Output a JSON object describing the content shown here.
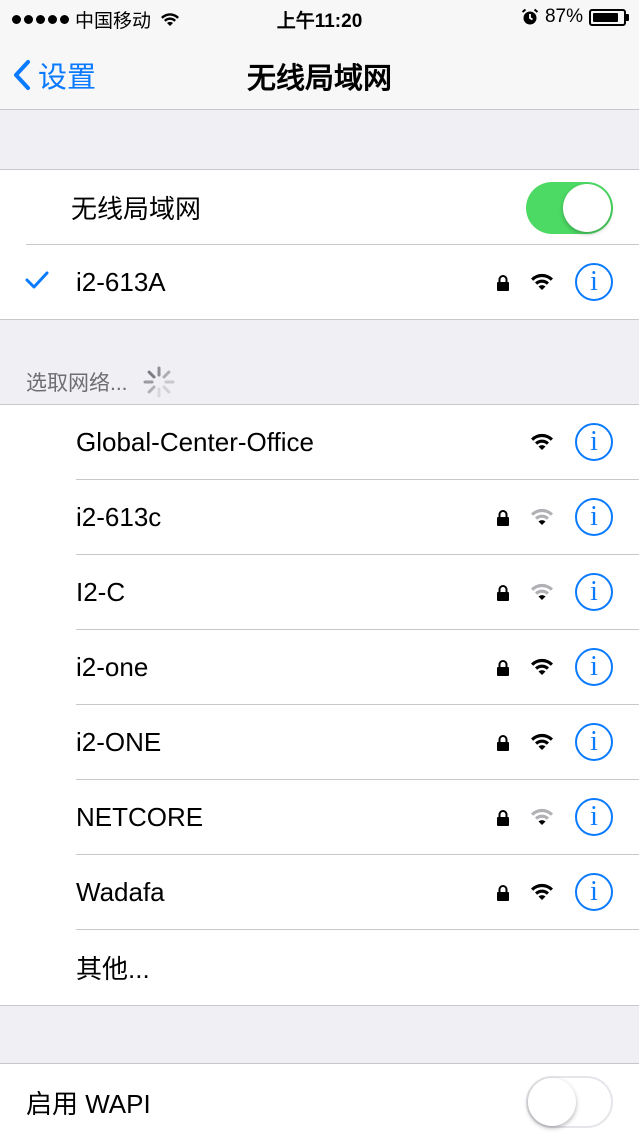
{
  "status_bar": {
    "carrier": "中国移动",
    "time": "上午11:20",
    "battery_percent": "87%",
    "signal_dots": 5,
    "battery_level": 0.87
  },
  "nav": {
    "back_label": "设置",
    "title": "无线局域网"
  },
  "wifi_toggle": {
    "label": "无线局域网",
    "state": "on"
  },
  "connected": {
    "name": "i2-613A",
    "secured": true,
    "signal": "full"
  },
  "networks_header": "选取网络...",
  "networks": [
    {
      "name": "Global-Center-Office",
      "secured": false,
      "signal": "full"
    },
    {
      "name": "i2-613c",
      "secured": true,
      "signal": "weak"
    },
    {
      "name": "I2-C",
      "secured": true,
      "signal": "weak"
    },
    {
      "name": "i2-one",
      "secured": true,
      "signal": "full"
    },
    {
      "name": "i2-ONE",
      "secured": true,
      "signal": "full"
    },
    {
      "name": "NETCORE",
      "secured": true,
      "signal": "weak"
    },
    {
      "name": "Wadafa",
      "secured": true,
      "signal": "full"
    }
  ],
  "other_label": "其他...",
  "wapi": {
    "label": "启用 WAPI",
    "state": "off"
  },
  "colors": {
    "accent": "#0a7aff",
    "toggle_on": "#4cd964",
    "separator": "#c8c7cc",
    "background": "#efeff4"
  },
  "icons": {
    "info": "i",
    "back": "chevron-left-icon",
    "lock": "lock-icon",
    "wifi": "wifi-icon",
    "check": "checkmark-icon"
  }
}
